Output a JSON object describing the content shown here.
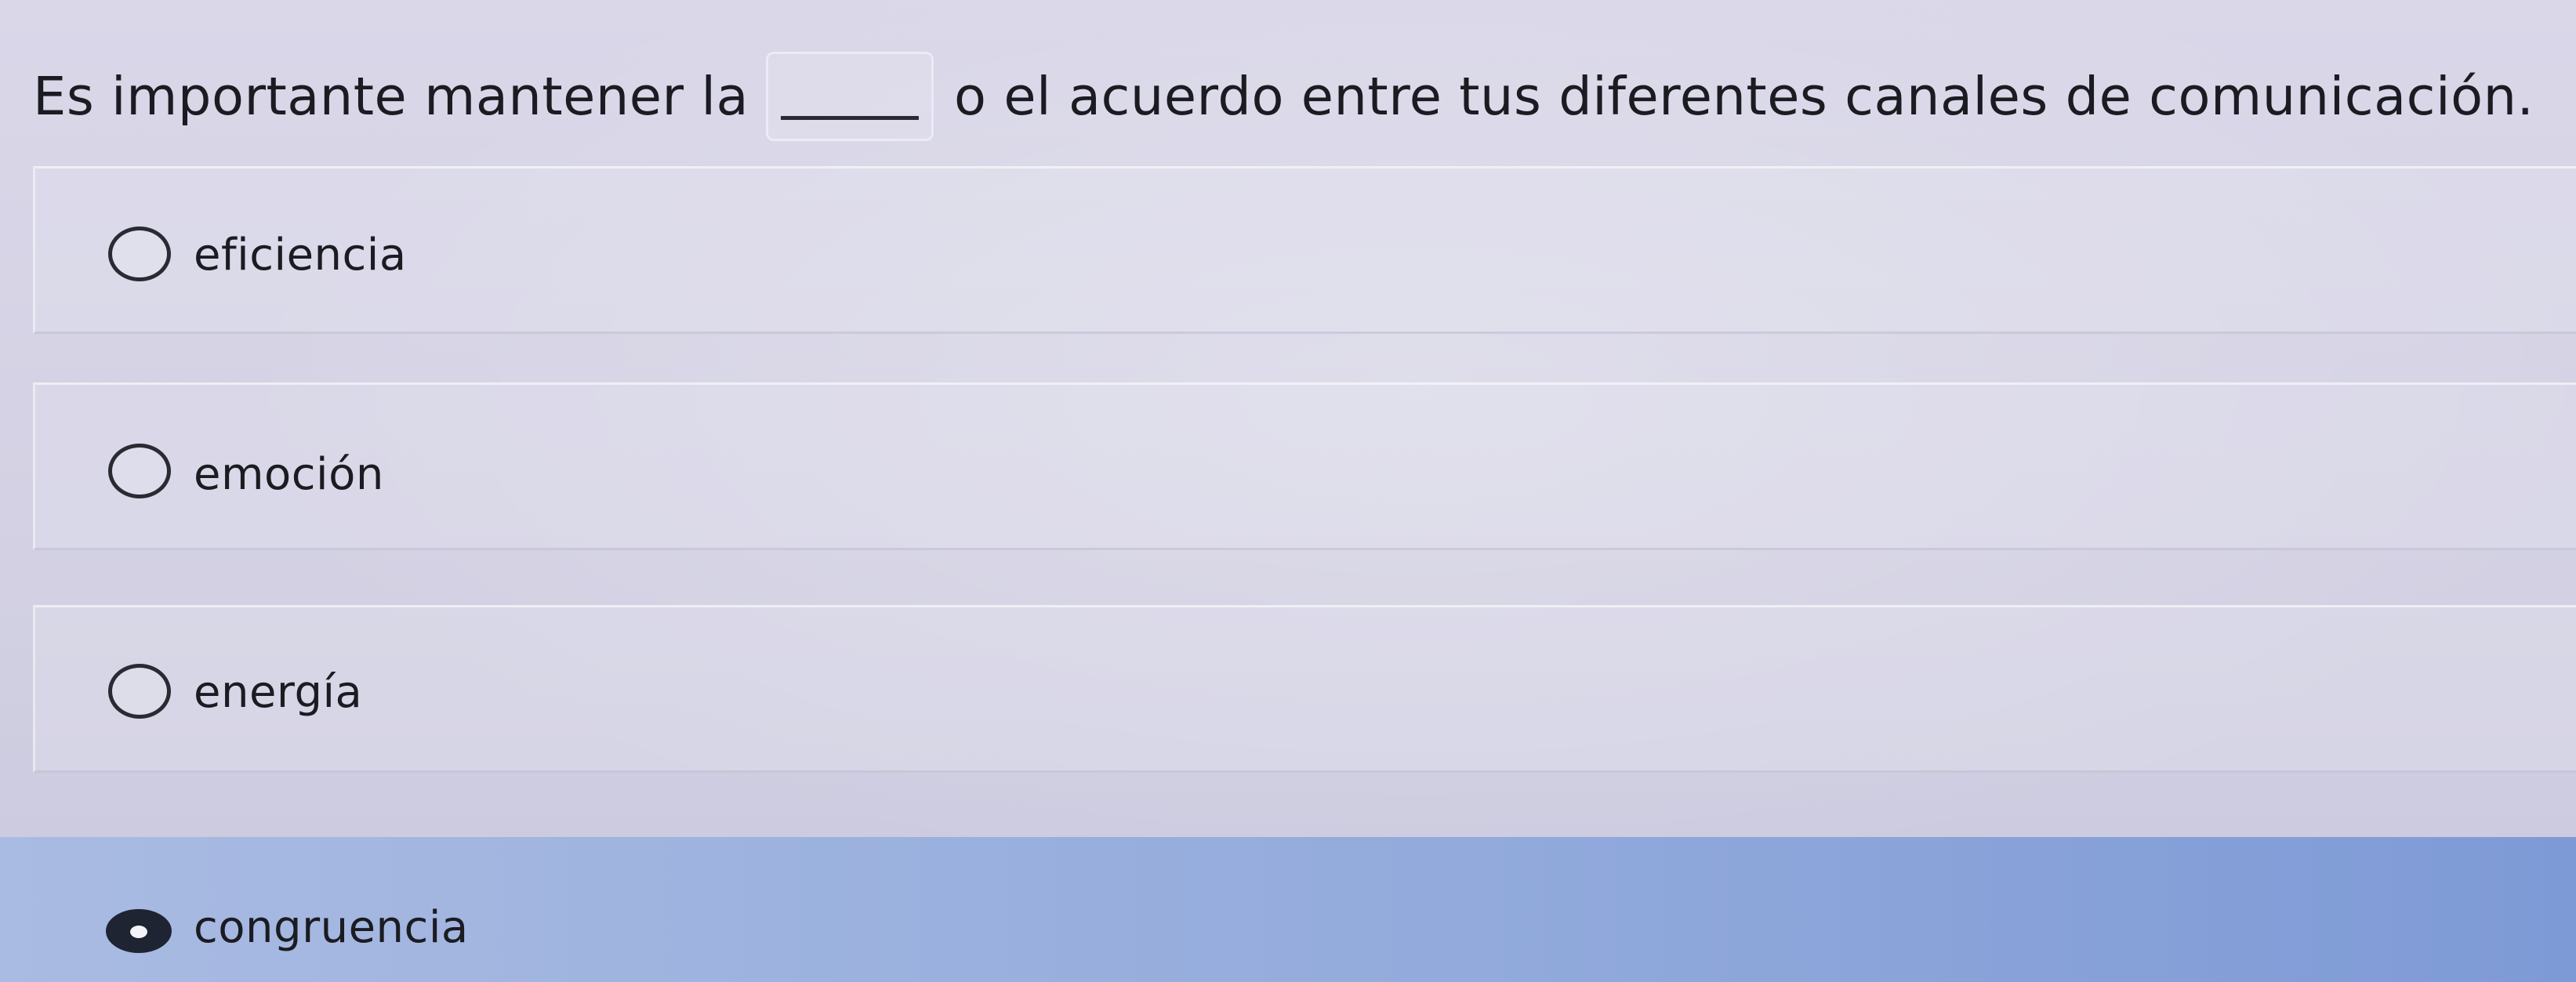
{
  "question": {
    "before_blank": "Es importante mantener la",
    "after_blank": "o el acuerdo entre tus diferentes canales de comunicación."
  },
  "options": [
    {
      "label": "eficiencia",
      "selected": false
    },
    {
      "label": "emoción",
      "selected": false
    },
    {
      "label": "energía",
      "selected": false
    },
    {
      "label": "congruencia",
      "selected": true
    }
  ],
  "colors": {
    "background": "#d6d4e4",
    "selected_row": "#93abdc",
    "text": "#1b1b22"
  }
}
